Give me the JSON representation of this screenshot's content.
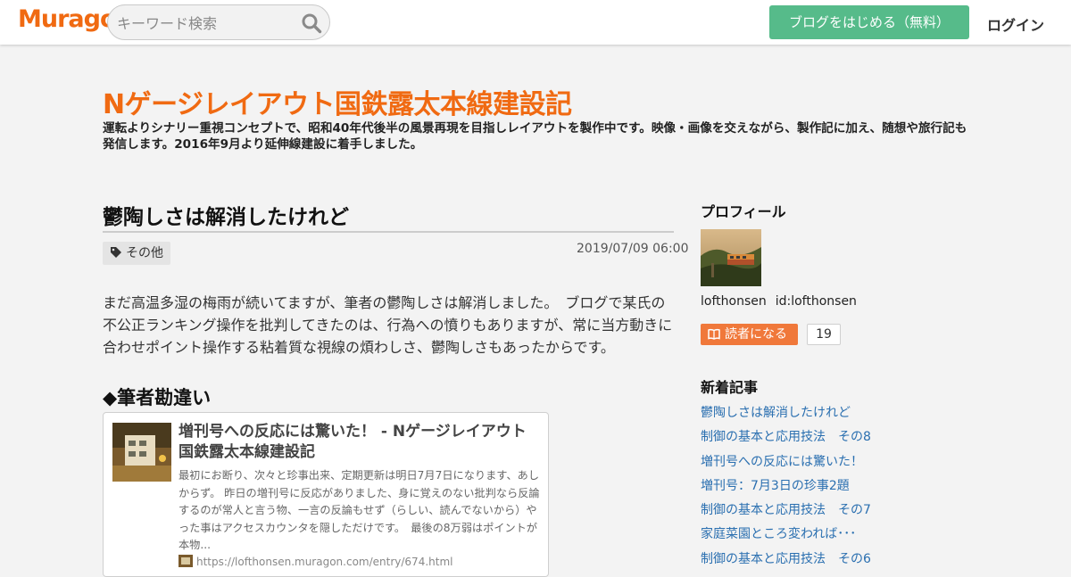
{
  "colors": {
    "brand": "#f06a12",
    "primary_button": "#56bb8a",
    "reader_button": "#f0783a",
    "link": "#2a6fb0"
  },
  "header": {
    "logo_text": "Muragon",
    "search_placeholder": "キーワード検索",
    "search_icon": "magnifier-icon",
    "start_blog_label": "ブログをはじめる（無料）",
    "login_label": "ログイン"
  },
  "blog": {
    "title": "Nゲージレイアウト国鉄露太本線建設記",
    "description": "運転よりシナリー重視コンセプトで、昭和40年代後半の風景再現を目指しレイアウトを製作中です。映像・画像を交えながら、製作記に加え、随想や旅行記も発信します。2016年9月より延伸線建設に着手しました。"
  },
  "entry": {
    "title": "鬱陶しさは解消したけれど",
    "category": "その他",
    "category_icon": "tag-icon",
    "date": "2019/07/09 06:00",
    "body": "まだ高温多湿の梅雨が続いてますが、筆者の鬱陶しさは解消しました。　ブログで某氏の不公正ランキング操作を批判してきたのは、行為への憤りもありますが、常に当方動きに合わせポイント操作する粘着質な視線の煩わしさ、鬱陶しさもあったからです。",
    "section_heading": "◆筆者勘違い",
    "link_card": {
      "title": "増刊号への反応には驚いた！ - Nゲージレイアウト国鉄露太本線建設記",
      "excerpt": "最初にお断り、次々と珍事出来、定期更新は明日7月7日になります、あしからず。 昨日の増刊号に反応がありました、身に覚えのない批判なら反論するのが常人と言う物、一言の反論もせず（らしい、読んでないから）やった事はアクセスカウンタを隠しただけです。　最後の8万弱はポイントが本物...",
      "url": "https://lofthonsen.muragon.com/entry/674.html"
    }
  },
  "sidebar": {
    "profile_heading": "プロフィール",
    "user_name": "lofthonsen",
    "user_id": "id:lofthonsen",
    "reader_button_label": "読者になる",
    "reader_icon": "book-icon",
    "reader_count": "19",
    "recent_heading": "新着記事",
    "recent_posts": [
      "鬱陶しさは解消したけれど",
      "制御の基本と応用技法　その8",
      "増刊号への反応には驚いた！",
      "増刊号：7月3日の珍事2題",
      "制御の基本と応用技法　その7",
      "家庭菜園ところ変われば･･･",
      "制御の基本と応用技法　その6"
    ]
  }
}
